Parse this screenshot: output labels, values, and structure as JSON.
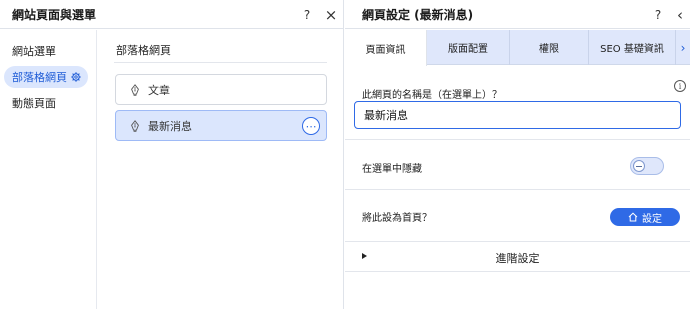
{
  "left_panel": {
    "title": "網站頁面與選單",
    "help": "?",
    "close": "×",
    "nav": [
      {
        "label": "網站選單"
      },
      {
        "label": "部落格網頁"
      },
      {
        "label": "動態頁面"
      }
    ],
    "section_title": "部落格網頁",
    "pages": [
      {
        "label": "文章"
      },
      {
        "label": "最新消息"
      }
    ],
    "more": "⋯"
  },
  "right_panel": {
    "title": "網頁設定 (最新消息)",
    "help": "?",
    "back": "‹",
    "tabs": [
      {
        "label": "頁面資訊"
      },
      {
        "label": "版面配置"
      },
      {
        "label": "權限"
      },
      {
        "label": "SEO 基礎資訊"
      }
    ],
    "tab_more": "›",
    "name_label": "此網頁的名稱是（在選單上）？",
    "name_value": "最新消息",
    "info": "i",
    "hide_label": "在選單中隱藏",
    "homepage_label": "將此設為首頁？",
    "set_button": "設定",
    "advanced_label": "進階設定"
  },
  "colors": {
    "accent": "#2f6ae6",
    "selected_bg": "#dbe6fd",
    "tabs_bg": "#dfe7fb"
  }
}
